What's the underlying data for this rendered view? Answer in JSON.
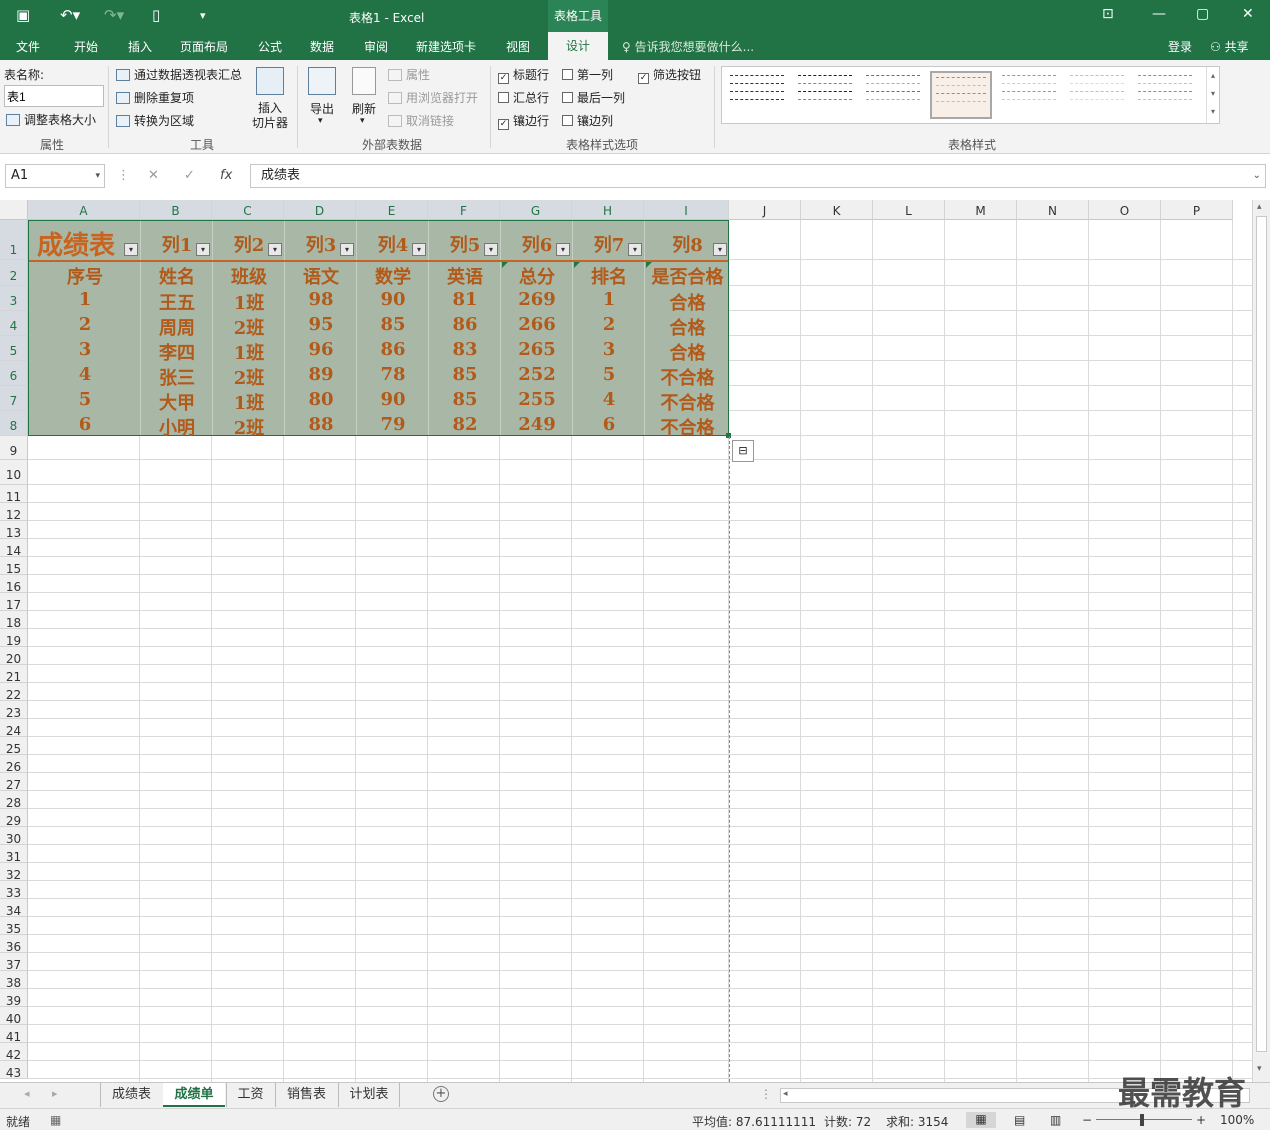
{
  "window": {
    "title": "表格1 - Excel",
    "tool_context": "表格工具",
    "tellme": "告诉我您想要做什么...",
    "login": "登录",
    "share": "共享"
  },
  "menu": [
    "文件",
    "开始",
    "插入",
    "页面布局",
    "公式",
    "数据",
    "审阅",
    "新建选项卡",
    "视图",
    "设计"
  ],
  "ribbon": {
    "props": {
      "name_label": "表名称:",
      "name_value": "表1",
      "resize": "调整表格大小",
      "group": "属性"
    },
    "tools": {
      "pivot": "通过数据透视表汇总",
      "dedupe": "删除重复项",
      "convert": "转换为区域",
      "slicer_line1": "插入",
      "slicer_line2": "切片器",
      "group": "工具"
    },
    "external": {
      "export": "导出",
      "refresh": "刷新",
      "properties": "属性",
      "open_browser": "用浏览器打开",
      "unlink": "取消链接",
      "group": "外部表数据"
    },
    "options": {
      "header_row": "标题行",
      "total_row": "汇总行",
      "banded_rows": "镶边行",
      "first_col": "第一列",
      "last_col": "最后一列",
      "banded_cols": "镶边列",
      "filter_btn": "筛选按钮",
      "group": "表格样式选项"
    },
    "styles_group": "表格样式",
    "swatch_colors": [
      "#333333",
      "#444444",
      "#4472c4",
      "#e07a3c",
      "#999999",
      "#f2c22e",
      "#5b9bd5"
    ]
  },
  "formula": {
    "namebox": "A1",
    "content": "成绩表",
    "fx": "fx"
  },
  "columns": [
    "A",
    "B",
    "C",
    "D",
    "E",
    "F",
    "G",
    "H",
    "I",
    "J",
    "K",
    "L",
    "M",
    "N",
    "O",
    "P"
  ],
  "rows": [
    "1",
    "2",
    "3",
    "4",
    "5",
    "6",
    "7",
    "8",
    "9",
    "10",
    "11",
    "12",
    "13",
    "14",
    "15",
    "16",
    "17",
    "18",
    "19",
    "20",
    "21",
    "22",
    "23",
    "24",
    "25",
    "26",
    "27",
    "28",
    "29",
    "30",
    "31",
    "32",
    "33",
    "34",
    "35",
    "36",
    "37",
    "38",
    "39",
    "40",
    "41",
    "42",
    "43"
  ],
  "table": {
    "headers": [
      "成绩表",
      "列1",
      "列2",
      "列3",
      "列4",
      "列5",
      "列6",
      "列7",
      "列8"
    ],
    "rows": [
      [
        "序号",
        "姓名",
        "班级",
        "语文",
        "数学",
        "英语",
        "总分",
        "排名",
        "是否合格"
      ],
      [
        "1",
        "王五",
        "1班",
        "98",
        "90",
        "81",
        "269",
        "1",
        "合格"
      ],
      [
        "2",
        "周周",
        "2班",
        "95",
        "85",
        "86",
        "266",
        "2",
        "合格"
      ],
      [
        "3",
        "李四",
        "1班",
        "96",
        "86",
        "83",
        "265",
        "3",
        "合格"
      ],
      [
        "4",
        "张三",
        "2班",
        "89",
        "78",
        "85",
        "252",
        "5",
        "不合格"
      ],
      [
        "5",
        "大甲",
        "1班",
        "80",
        "90",
        "85",
        "255",
        "4",
        "不合格"
      ],
      [
        "6",
        "小明",
        "2班",
        "88",
        "79",
        "82",
        "249",
        "6",
        "不合格"
      ]
    ]
  },
  "sheets": [
    "成绩表",
    "成绩单",
    "工资",
    "销售表",
    "计划表"
  ],
  "active_sheet": "成绩单",
  "status": {
    "ready": "就绪",
    "average": "平均值: 87.61111111",
    "count": "计数: 72",
    "sum": "求和: 3154",
    "zoom": "100%"
  },
  "watermark": "最需教育"
}
